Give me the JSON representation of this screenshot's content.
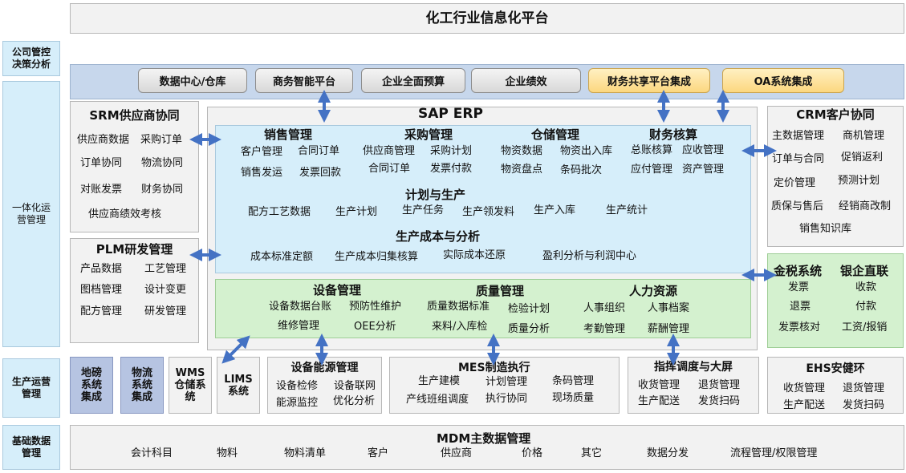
{
  "title": "化工行业信息化平台",
  "side": {
    "decision": "公司管控决策分析",
    "integrated": "一体化运营管理",
    "production": "生产运营管理",
    "basic": "基础数据管理"
  },
  "top_bar": [
    "数据中心/仓库",
    "商务智能平台",
    "企业全面预算",
    "企业绩效",
    "财务共享平台集成",
    "OA系统集成"
  ],
  "srm": {
    "title": "SRM供应商协同",
    "items": [
      "供应商数据",
      "采购订单",
      "订单协同",
      "物流协同",
      "对账发票",
      "财务协同",
      "供应商绩效考核"
    ]
  },
  "plm": {
    "title": "PLM研发管理",
    "items": [
      "产品数据",
      "工艺管理",
      "图档管理",
      "设计变更",
      "配方管理",
      "研发管理"
    ]
  },
  "sap": {
    "title": "SAP ERP",
    "sales": {
      "title": "销售管理",
      "items": [
        "客户管理",
        "合同订单",
        "销售发运",
        "发票回款"
      ]
    },
    "purchase": {
      "title": "采购管理",
      "items": [
        "供应商管理",
        "采购计划",
        "合同订单",
        "发票付款"
      ]
    },
    "warehouse": {
      "title": "仓储管理",
      "items": [
        "物资数据",
        "物资出入库",
        "物资盘点",
        "条码批次"
      ]
    },
    "finance": {
      "title": "财务核算",
      "items": [
        "总账核算",
        "应收管理",
        "应付管理",
        "资产管理"
      ]
    },
    "plan": {
      "title": "计划与生产",
      "items": [
        "配方工艺数据",
        "生产计划",
        "生产任务",
        "生产领发料",
        "生产入库",
        "生产统计"
      ]
    },
    "cost": {
      "title": "生产成本与分析",
      "items": [
        "成本标准定额",
        "生产成本归集核算",
        "实际成本还原",
        "盈利分析与利润中心"
      ]
    }
  },
  "green": {
    "equipment": {
      "title": "设备管理",
      "items": [
        "设备数据台账",
        "预防性维护",
        "维修管理",
        "OEE分析"
      ]
    },
    "quality": {
      "title": "质量管理",
      "items": [
        "质量数据标准",
        "检验计划",
        "来料/入库检",
        "质量分析"
      ]
    },
    "hr": {
      "title": "人力资源",
      "items": [
        "人事组织",
        "人事档案",
        "考勤管理",
        "薪酬管理"
      ]
    }
  },
  "crm": {
    "title": "CRM客户协同",
    "items": [
      "主数据管理",
      "商机管理",
      "订单与合同",
      "促销返利",
      "定价管理",
      "预测计划",
      "质保与售后",
      "经销商改制",
      "销售知识库"
    ]
  },
  "tax": {
    "title1": "金税系统",
    "title2": "银企直联",
    "items": [
      "发票",
      "收款",
      "退票",
      "付款",
      "发票核对",
      "工资/报销"
    ]
  },
  "prod": {
    "dibang": "地磅系统集成",
    "wuliu": "物流系统集成",
    "wms": "WMS仓储系统",
    "lims": "LIMS系统",
    "energy": {
      "title": "设备能源管理",
      "items": [
        "设备检修",
        "设备联网",
        "能源监控",
        "优化分析"
      ]
    },
    "mes": {
      "title": "MES制造执行",
      "items": [
        "生产建模",
        "计划管理",
        "条码管理",
        "产线班组调度",
        "执行协同",
        "现场质量"
      ]
    },
    "dispatch": {
      "title": "指挥调度与大屏",
      "items": [
        "收货管理",
        "退货管理",
        "生产配送",
        "发货扫码"
      ]
    },
    "ehs": {
      "title": "EHS安健环",
      "items": [
        "收货管理",
        "退货管理",
        "生产配送",
        "发货扫码"
      ]
    }
  },
  "mdm": {
    "title": "MDM主数据管理",
    "items": [
      "会计科目",
      "物料",
      "物料清单",
      "客户",
      "供应商",
      "价格",
      "其它",
      "数据分发",
      "流程管理/权限管理"
    ]
  },
  "colors": {
    "arrow": "#4472c4"
  }
}
